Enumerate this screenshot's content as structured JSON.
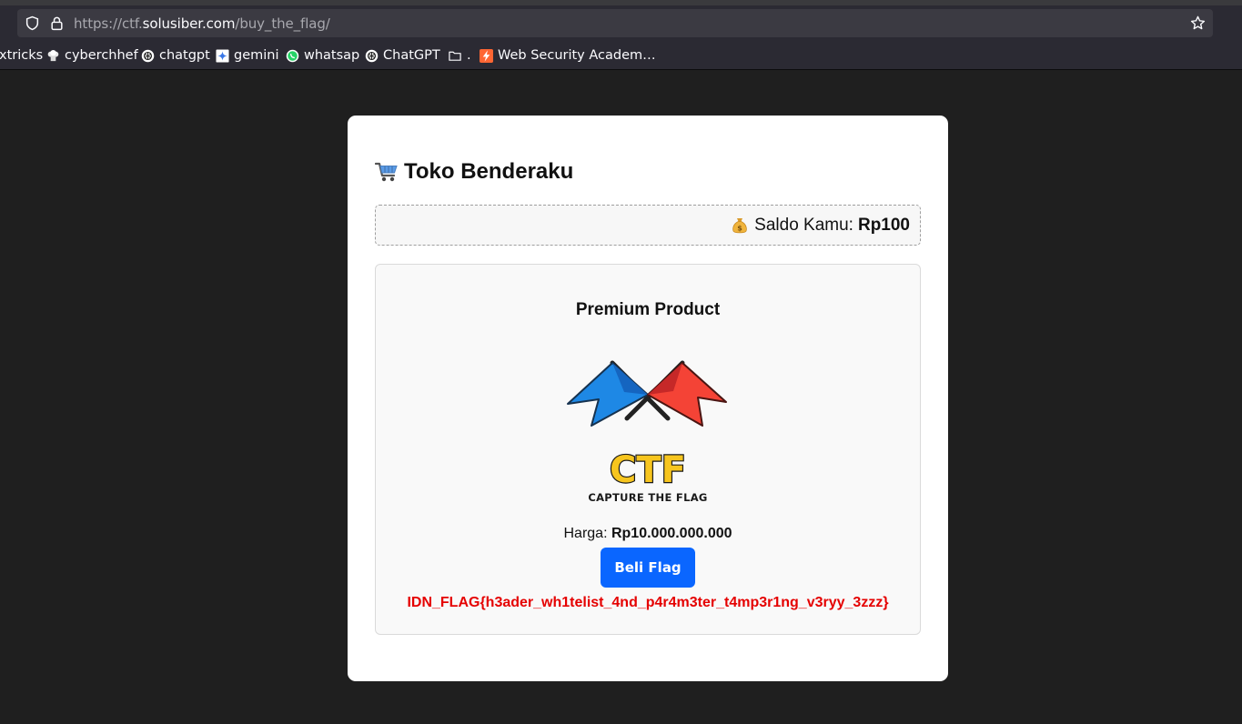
{
  "browser": {
    "url_prefix": "https://ctf.",
    "url_host": "solusiber.com",
    "url_path": "/buy_the_flag/",
    "bookmarks": [
      {
        "label": "xtricks",
        "icon": "none"
      },
      {
        "label": "cyberchhef",
        "icon": "chef-hat-icon"
      },
      {
        "label": "chatgpt",
        "icon": "openai-icon"
      },
      {
        "label": "gemini",
        "icon": "gemini-icon"
      },
      {
        "label": "whatsap",
        "icon": "whatsapp-icon"
      },
      {
        "label": "ChatGPT",
        "icon": "openai-icon"
      },
      {
        "label": ".",
        "icon": "folder-icon"
      },
      {
        "label": "Web Security Academ…",
        "icon": "portswigger-icon"
      }
    ]
  },
  "page": {
    "title": "Toko Benderaku",
    "balance_label": "Saldo Kamu:",
    "balance_value": "Rp100",
    "product_name": "Premium Product",
    "logo_text": "CTF",
    "logo_subtext": "CAPTURE THE FLAG",
    "price_label": "Harga:",
    "price_value": "Rp10.000.000.000",
    "buy_button": "Beli Flag",
    "flag_text": "IDN_FLAG{h3ader_wh1telist_4nd_p4r4m3ter_t4mp3r1ng_v3ryy_3zzz}"
  },
  "colors": {
    "page_background": "#1f1f1f",
    "button": "#0a66ff",
    "flag_text": "#e50000",
    "flag_blue": "#1e88e5",
    "flag_red": "#f44336",
    "logo_yellow": "#f7c51e"
  }
}
